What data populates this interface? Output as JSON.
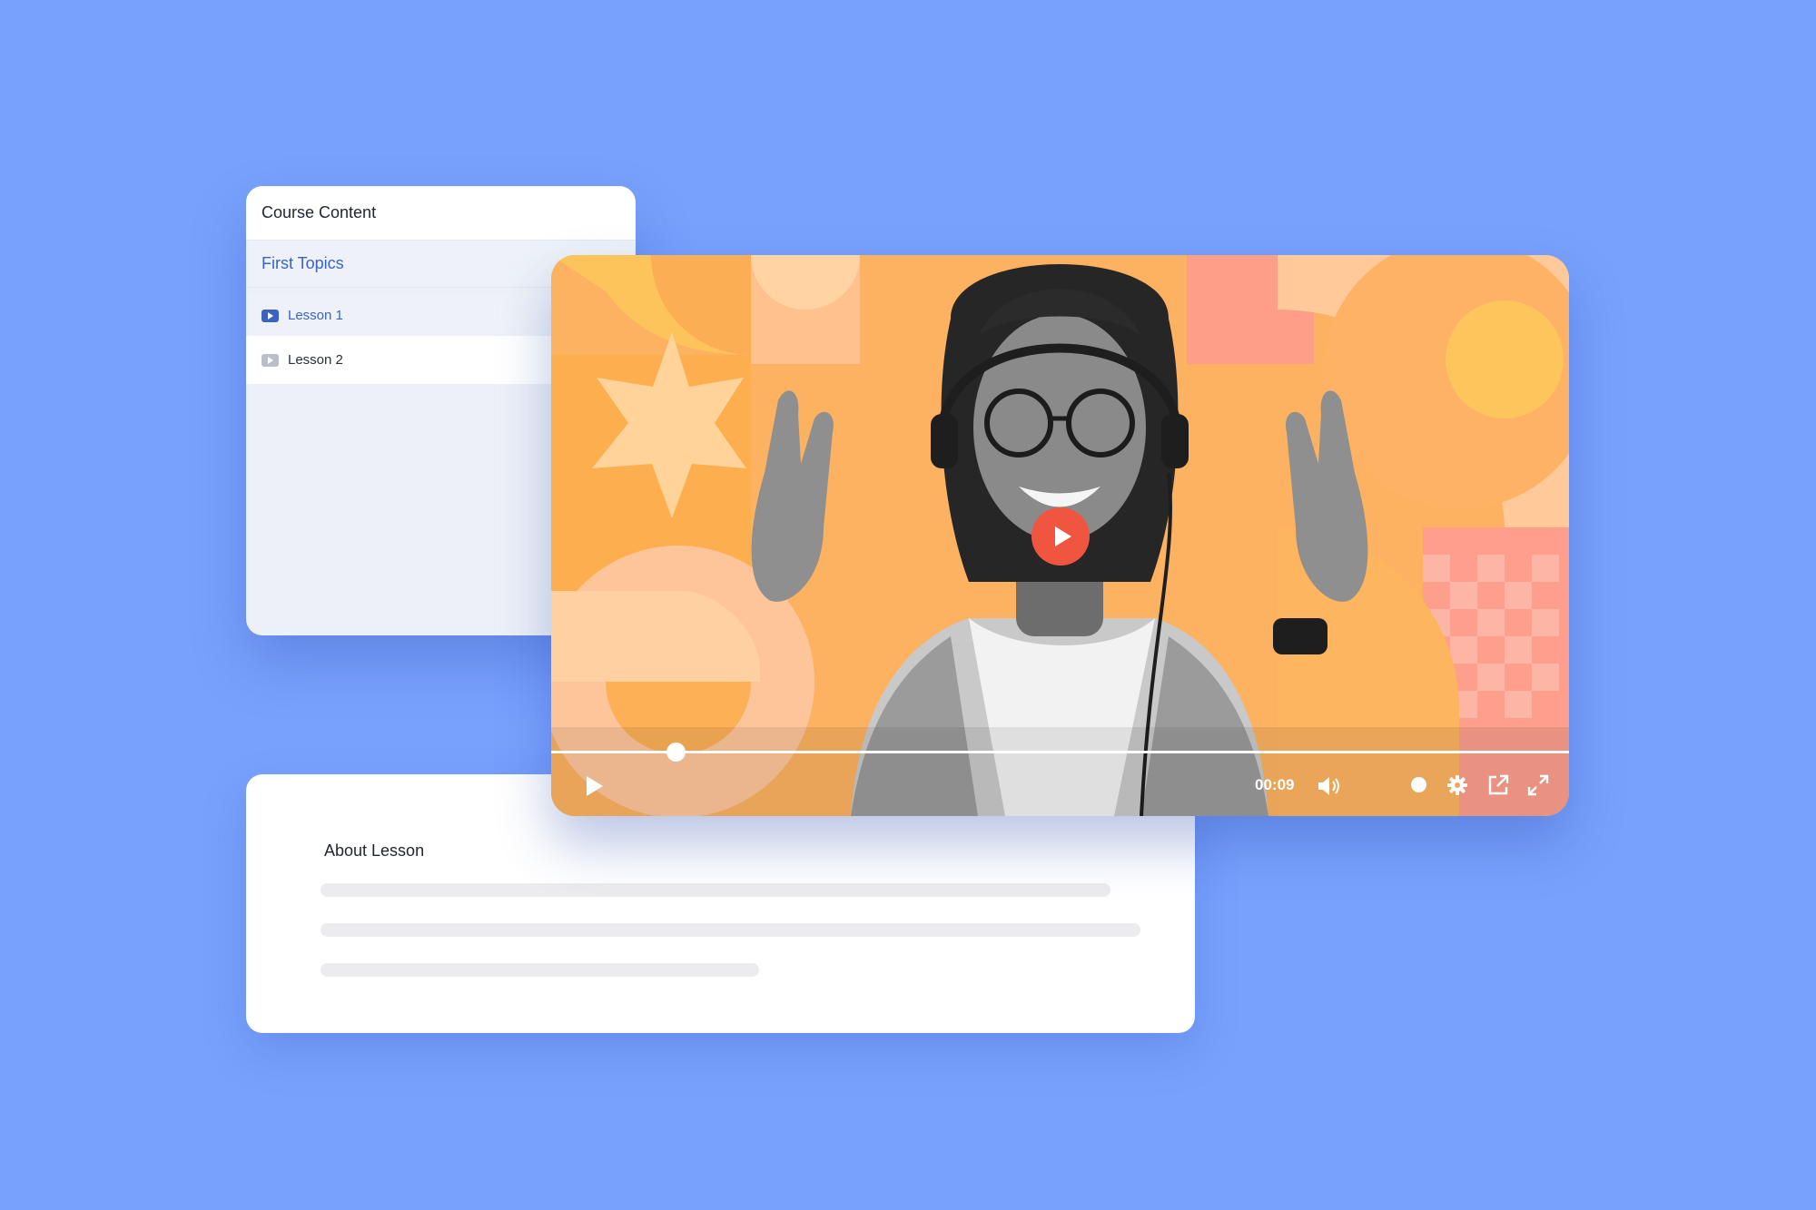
{
  "course": {
    "header": "Course Content",
    "topic": "First Topics",
    "lessons": [
      {
        "label": "Lesson 1",
        "active": true
      },
      {
        "label": "Lesson 2",
        "active": false
      }
    ]
  },
  "about": {
    "title": "About Lesson"
  },
  "player": {
    "time": "00:09",
    "progress_fraction": 0.122
  },
  "colors": {
    "background": "#78a1fd",
    "accent_blue": "#3b63c2",
    "play_red": "#f0553f"
  }
}
